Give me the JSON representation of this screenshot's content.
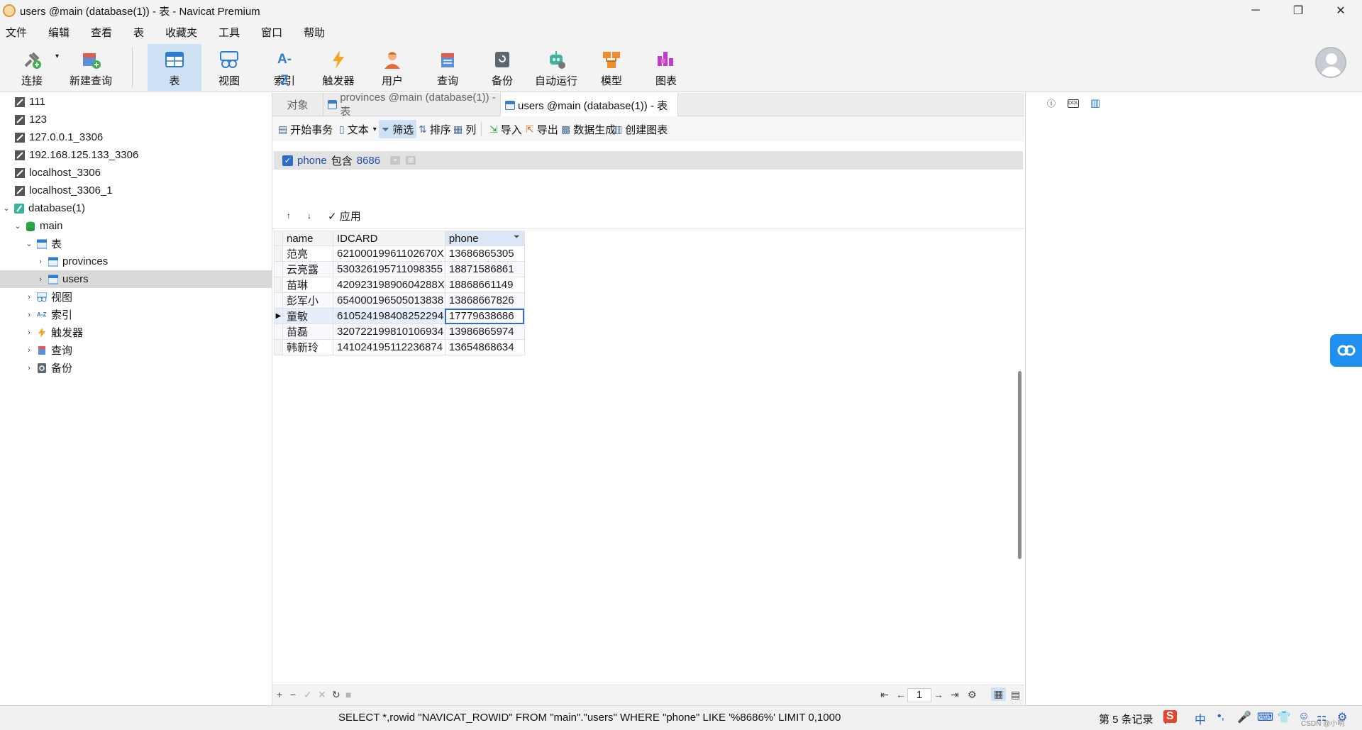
{
  "window": {
    "title": "users @main (database(1)) - 表 - Navicat Premium"
  },
  "window_controls": {
    "minimize": "─",
    "restore": "❐",
    "close": "✕"
  },
  "menu": [
    "文件",
    "编辑",
    "查看",
    "表",
    "收藏夹",
    "工具",
    "窗口",
    "帮助"
  ],
  "toolbar": {
    "items": [
      "连接",
      "新建查询",
      "表",
      "视图",
      "索引",
      "触发器",
      "用户",
      "查询",
      "备份",
      "自动运行",
      "模型",
      "图表"
    ],
    "active": "表",
    "connect_dropdown": "▾",
    "index_icon_text": "A-Z"
  },
  "tree": {
    "items": [
      {
        "label": "111",
        "icon": "connection-icon"
      },
      {
        "label": "123",
        "icon": "connection-icon"
      },
      {
        "label": "127.0.0.1_3306",
        "icon": "connection-icon"
      },
      {
        "label": "192.168.125.133_3306",
        "icon": "connection-icon"
      },
      {
        "label": "localhost_3306",
        "icon": "connection-icon"
      },
      {
        "label": "localhost_3306_1",
        "icon": "connection-icon"
      },
      {
        "label": "database(1)",
        "icon": "sqlite-connection-icon",
        "expanded": true
      },
      {
        "label": "main",
        "icon": "database-icon",
        "expanded": true
      },
      {
        "label": "表",
        "icon": "tables-folder-icon",
        "expanded": true
      },
      {
        "label": "provinces",
        "icon": "table-icon"
      },
      {
        "label": "users",
        "icon": "table-icon",
        "selected": true
      },
      {
        "label": "视图",
        "icon": "views-folder-icon"
      },
      {
        "label": "索引",
        "icon": "index-folder-icon"
      },
      {
        "label": "触发器",
        "icon": "trigger-folder-icon"
      },
      {
        "label": "查询",
        "icon": "query-folder-icon"
      },
      {
        "label": "备份",
        "icon": "backup-folder-icon"
      }
    ],
    "chevron_open": "⌄",
    "chevron_closed": "›"
  },
  "tabs": [
    {
      "label": "对象",
      "active": false
    },
    {
      "label": "provinces @main (database(1)) - 表",
      "active": false
    },
    {
      "label": "users @main (database(1)) - 表",
      "active": true
    }
  ],
  "subtoolbar": {
    "begin_transaction": "开始事务",
    "text": "文本",
    "filter": "筛选",
    "sort": "排序",
    "columns": "列",
    "import": "导入",
    "export": "导出",
    "generate_data": "数据生成",
    "create_chart": "创建图表"
  },
  "filter": {
    "field": "phone",
    "operator": "包含",
    "value": "8686"
  },
  "apply": {
    "up": "↑",
    "down": "↓",
    "label": "✓ 应用"
  },
  "grid": {
    "columns": [
      "name",
      "IDCARD",
      "phone"
    ],
    "filtered_column": "phone",
    "rows": [
      {
        "name": "范亮",
        "IDCARD": "62100019961102670X",
        "phone": "13686865305"
      },
      {
        "name": "云亮露",
        "IDCARD": "530326195711098355",
        "phone": "18871586861"
      },
      {
        "name": "苗琳",
        "IDCARD": "42092319890604288X",
        "phone": "18868661149"
      },
      {
        "name": "彭军小",
        "IDCARD": "654000196505013838",
        "phone": "13868667826"
      },
      {
        "name": "童敏",
        "IDCARD": "610524198408252294",
        "phone": "17779638686"
      },
      {
        "name": "苗磊",
        "IDCARD": "320722199810106934",
        "phone": "13986865974"
      },
      {
        "name": "韩新玲",
        "IDCARD": "141024195112236874",
        "phone": "13654868634"
      }
    ],
    "current_row": 4,
    "current_marker": "▶"
  },
  "nav": {
    "add": "+",
    "remove": "−",
    "save": "✓",
    "discard": "✕",
    "refresh": "↻",
    "stop": "■",
    "first": "⇤",
    "prev": "←",
    "page": "1",
    "next": "→",
    "last": "⇥",
    "settings": "⚙",
    "grid_view": "▦",
    "form_view": "▤"
  },
  "right_panel": {
    "info": "ⓘ",
    "ddl": "DDL",
    "layout": "▥"
  },
  "statusbar": {
    "sql": "SELECT *,rowid \"NAVICAT_ROWID\" FROM \"main\".\"users\" WHERE \"phone\" LIKE '%8686%' LIMIT 0,1000",
    "records": "第 5 条记录 （",
    "tray": [
      "S",
      "中",
      "•,",
      "🎤",
      "⌨",
      "👕",
      "☺",
      "⚏",
      "⚙"
    ],
    "watermark": "CSDN @小明"
  },
  "colors": {
    "accent": "#2c6fd1",
    "toolbar_active": "#cfe2f5",
    "filter_blue": "#1f4db4",
    "float_button": "#1f8ff0"
  }
}
